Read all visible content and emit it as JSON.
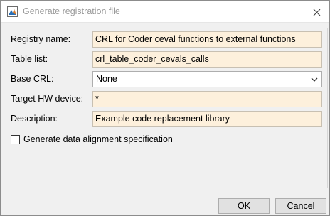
{
  "window": {
    "title": "Generate registration file",
    "close_icon": "close-icon",
    "app_icon": "matlab-window-icon"
  },
  "form": {
    "registry_name": {
      "label": "Registry name:",
      "value": "CRL for Coder ceval functions to external functions"
    },
    "table_list": {
      "label": "Table list:",
      "value": "crl_table_coder_cevals_calls"
    },
    "base_crl": {
      "label": "Base CRL:",
      "value": "None"
    },
    "target_hw": {
      "label": "Target HW device:",
      "value": "*"
    },
    "description": {
      "label": "Description:",
      "value": "Example code replacement library"
    },
    "data_alignment": {
      "label": "Generate data alignment specification",
      "checked": false
    }
  },
  "buttons": {
    "ok": "OK",
    "cancel": "Cancel"
  },
  "colors": {
    "field_bg": "#fdf0dc",
    "dialog_bg": "#f0f0f0"
  }
}
